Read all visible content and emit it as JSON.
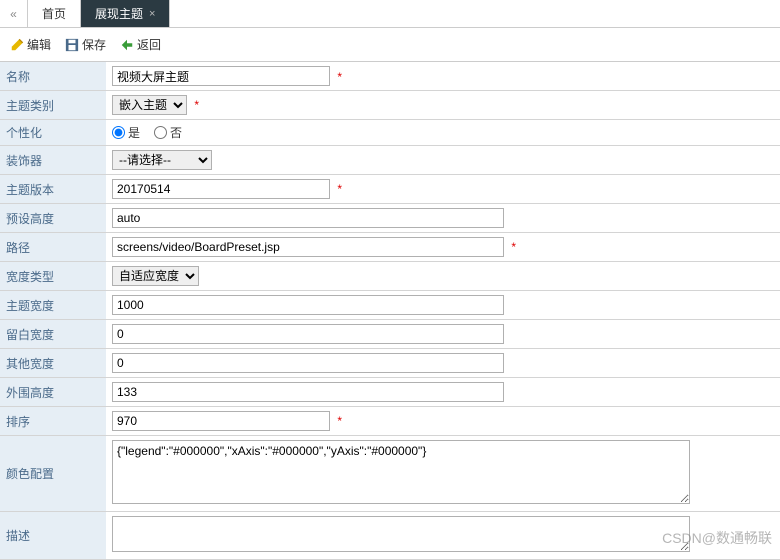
{
  "tabs": {
    "back": "«",
    "home": "首页",
    "active": "展现主题",
    "close": "×"
  },
  "toolbar": {
    "edit": "编辑",
    "save": "保存",
    "back": "返回"
  },
  "form": {
    "name": {
      "label": "名称",
      "value": "视频大屏主题"
    },
    "category": {
      "label": "主题类别",
      "selected": "嵌入主题",
      "dropdown": "▼"
    },
    "personalize": {
      "label": "个性化",
      "yes": "是",
      "no": "否"
    },
    "decorator": {
      "label": "装饰器",
      "selected": "--请选择--",
      "dropdown": "▼"
    },
    "version": {
      "label": "主题版本",
      "value": "20170514"
    },
    "preset_height": {
      "label": "预设高度",
      "value": "auto"
    },
    "path": {
      "label": "路径",
      "value": "screens/video/BoardPreset.jsp"
    },
    "width_type": {
      "label": "宽度类型",
      "selected": "自适应宽度",
      "dropdown": "▼"
    },
    "theme_width": {
      "label": "主题宽度",
      "value": "1000"
    },
    "margin_width": {
      "label": "留白宽度",
      "value": "0"
    },
    "other_width": {
      "label": "其他宽度",
      "value": "0"
    },
    "outer_height": {
      "label": "外围高度",
      "value": "133"
    },
    "sort": {
      "label": "排序",
      "value": "970"
    },
    "color_config": {
      "label": "颜色配置",
      "value": "{\"legend\":\"#000000\",\"xAxis\":\"#000000\",\"yAxis\":\"#000000\"}"
    },
    "description": {
      "label": "描述",
      "value": ""
    }
  },
  "required_mark": "*",
  "watermark": "CSDN@数通畅联"
}
